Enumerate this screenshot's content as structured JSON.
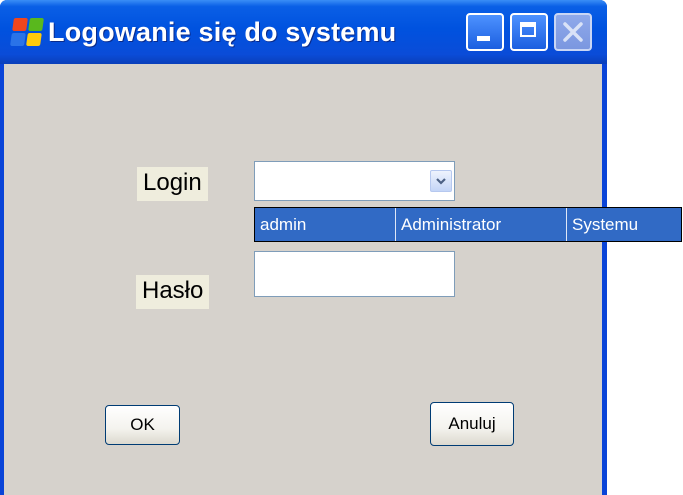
{
  "window": {
    "title": "Logowanie się do systemu",
    "app_icon": "windows-flag-icon",
    "controls": [
      "minimize-icon",
      "maximize-icon",
      "close-icon"
    ],
    "colors": {
      "titlebar": "#0a4cd8",
      "background": "#d6d2cc",
      "selection": "#316ac5"
    }
  },
  "form": {
    "login_label": "Login",
    "login_value": "",
    "login_options": [
      {
        "cells": [
          "admin",
          "Administrator",
          "Systemu"
        ]
      }
    ],
    "password_label": "Hasło",
    "password_value": ""
  },
  "buttons": {
    "ok_label": "OK",
    "cancel_label": "Anuluj"
  }
}
